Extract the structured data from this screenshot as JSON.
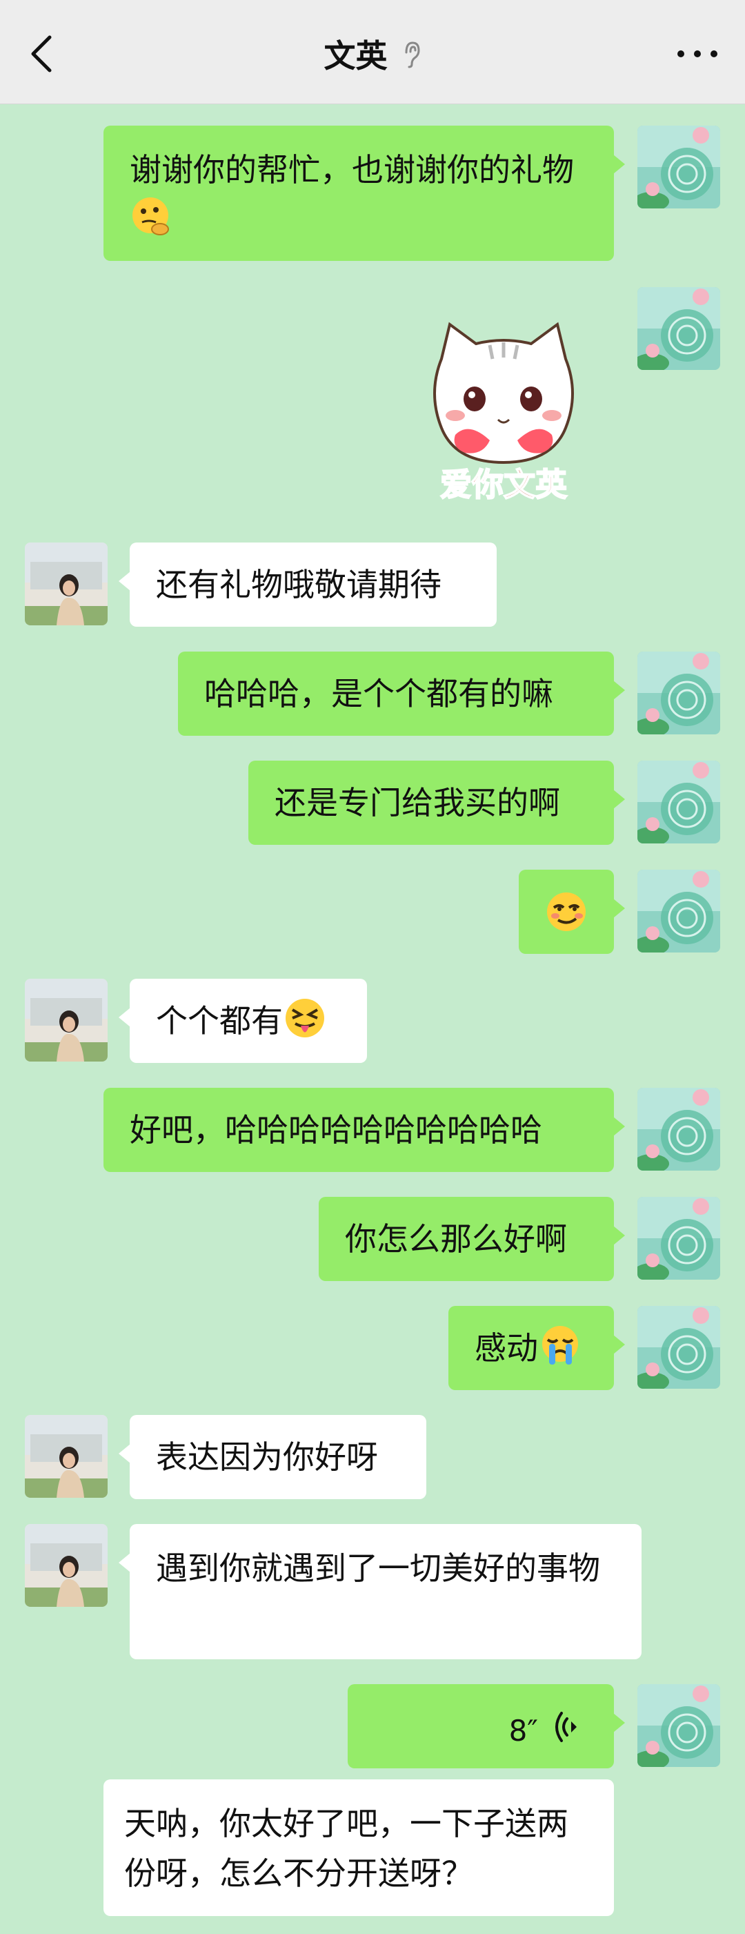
{
  "header": {
    "title": "文英"
  },
  "messages": {
    "m1": {
      "text": "谢谢你的帮忙，也谢谢你的礼物",
      "emoji": "emoji-thinking"
    },
    "m2": {
      "sticker_text": "爱你文英"
    },
    "m3": {
      "text": "还有礼物哦敬请期待"
    },
    "m4": {
      "text": "哈哈哈，是个个都有的嘛"
    },
    "m5": {
      "text": "还是专门给我买的啊"
    },
    "m6": {
      "emoji": "emoji-smirk"
    },
    "m7": {
      "text": "个个都有",
      "emoji": "emoji-tongue"
    },
    "m8": {
      "text": "好吧，哈哈哈哈哈哈哈哈哈哈"
    },
    "m9": {
      "text": "你怎么那么好啊"
    },
    "m10": {
      "text": "感动",
      "emoji": "emoji-crying"
    },
    "m11": {
      "text": "表达因为你好呀"
    },
    "m12": {
      "text": "遇到你就遇到了一切美好的事物"
    },
    "m13": {
      "duration": "8″"
    },
    "m14": {
      "text": "天呐，你太好了吧，一下子送两份呀，怎么不分开送呀？"
    }
  },
  "colors": {
    "outgoing": "#95ec69",
    "incoming": "#ffffff",
    "background": "#c5ebcd",
    "header": "#ededed"
  }
}
